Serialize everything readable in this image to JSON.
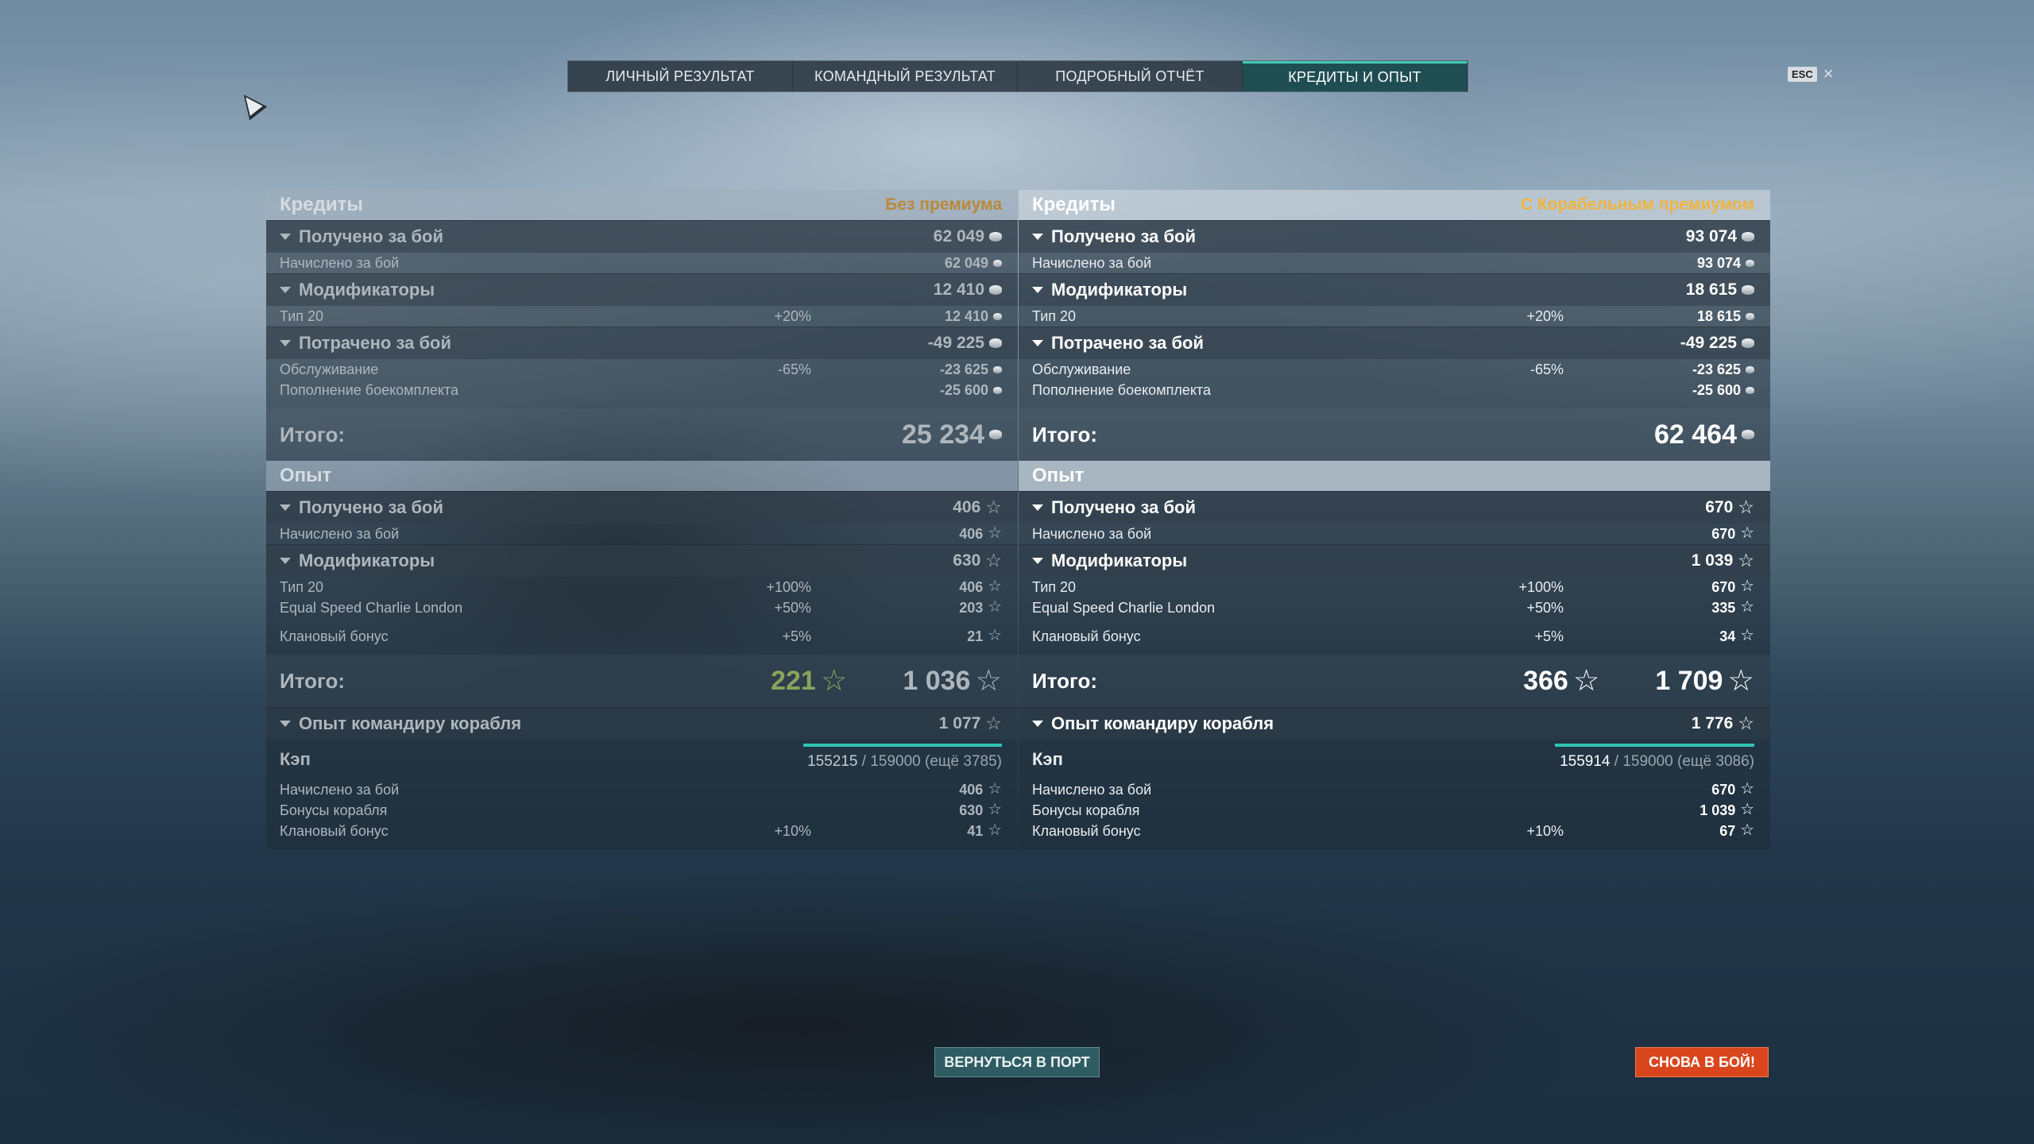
{
  "tabs": [
    "ЛИЧНЫЙ РЕЗУЛЬТАТ",
    "КОМАНДНЫЙ РЕЗУЛЬТАТ",
    "ПОДРОБНЫЙ ОТЧЁТ",
    "КРЕДИТЫ И ОПЫТ"
  ],
  "esc": {
    "key": "ESC",
    "close": "×"
  },
  "icons": {
    "credits": "credit-coin-icon",
    "xp": "star-icon",
    "collapse": "triangle-down-icon"
  },
  "colors": {
    "accent": "#43c9b4",
    "premium": "#f0b43c",
    "battle_button": "#d9461e",
    "bonus_green": "#9fd34a"
  },
  "left": {
    "credits": {
      "title": "Кредиты",
      "premium": "Без премиума",
      "earned": {
        "label": "Получено за бой",
        "value": "62 049",
        "rows": [
          {
            "label": "Начислено за бой",
            "pct": "",
            "value": "62 049"
          }
        ]
      },
      "modifiers": {
        "label": "Модификаторы",
        "value": "12 410",
        "rows": [
          {
            "label": "Тип 20",
            "pct": "+20%",
            "value": "12 410"
          }
        ]
      },
      "spent": {
        "label": "Потрачено за бой",
        "value": "-49 225",
        "rows": [
          {
            "label": "Обслуживание",
            "pct": "-65%",
            "value": "-23 625"
          },
          {
            "label": "Пополнение боекомплекта",
            "pct": "",
            "value": "-25 600"
          }
        ]
      },
      "total": {
        "label": "Итого:",
        "value": "25 234"
      }
    },
    "xp": {
      "title": "Опыт",
      "earned": {
        "label": "Получено за бой",
        "value": "406",
        "rows": [
          {
            "label": "Начислено за бой",
            "pct": "",
            "value": "406"
          }
        ]
      },
      "modifiers": {
        "label": "Модификаторы",
        "value": "630",
        "rows": [
          {
            "label": "Тип 20",
            "pct": "+100%",
            "value": "406"
          },
          {
            "label": "Equal Speed Charlie London",
            "pct": "+50%",
            "value": "203"
          }
        ],
        "clan": {
          "label": "Клановый бонус",
          "pct": "+5%",
          "value": "21"
        }
      },
      "total": {
        "label": "Итого:",
        "free": "221",
        "value": "1 036"
      },
      "commander": {
        "label": "Опыт командиру корабля",
        "value": "1 077"
      },
      "cap": {
        "label": "Кэп",
        "current": "155215",
        "max": "/ 159000 (ещё 3785)",
        "progress": 0.976,
        "rows": [
          {
            "label": "Начислено за бой",
            "pct": "",
            "value": "406"
          },
          {
            "label": "Бонусы корабля",
            "pct": "",
            "value": "630"
          },
          {
            "label": "Клановый бонус",
            "pct": "+10%",
            "value": "41"
          }
        ]
      }
    }
  },
  "right": {
    "credits": {
      "title": "Кредиты",
      "premium": "С Корабельным премиумом",
      "earned": {
        "label": "Получено за бой",
        "value": "93 074",
        "rows": [
          {
            "label": "Начислено за бой",
            "pct": "",
            "value": "93 074"
          }
        ]
      },
      "modifiers": {
        "label": "Модификаторы",
        "value": "18 615",
        "rows": [
          {
            "label": "Тип 20",
            "pct": "+20%",
            "value": "18 615"
          }
        ]
      },
      "spent": {
        "label": "Потрачено за бой",
        "value": "-49 225",
        "rows": [
          {
            "label": "Обслуживание",
            "pct": "-65%",
            "value": "-23 625"
          },
          {
            "label": "Пополнение боекомплекта",
            "pct": "",
            "value": "-25 600"
          }
        ]
      },
      "total": {
        "label": "Итого:",
        "value": "62 464"
      }
    },
    "xp": {
      "title": "Опыт",
      "earned": {
        "label": "Получено за бой",
        "value": "670",
        "rows": [
          {
            "label": "Начислено за бой",
            "pct": "",
            "value": "670"
          }
        ]
      },
      "modifiers": {
        "label": "Модификаторы",
        "value": "1 039",
        "rows": [
          {
            "label": "Тип 20",
            "pct": "+100%",
            "value": "670"
          },
          {
            "label": "Equal Speed Charlie London",
            "pct": "+50%",
            "value": "335"
          }
        ],
        "clan": {
          "label": "Клановый бонус",
          "pct": "+5%",
          "value": "34"
        }
      },
      "total": {
        "label": "Итого:",
        "free": "366",
        "value": "1 709"
      },
      "commander": {
        "label": "Опыт командиру корабля",
        "value": "1 776"
      },
      "cap": {
        "label": "Кэп",
        "current": "155914",
        "max": "/ 159000 (ещё 3086)",
        "progress": 0.981,
        "rows": [
          {
            "label": "Начислено за бой",
            "pct": "",
            "value": "670"
          },
          {
            "label": "Бонусы корабля",
            "pct": "",
            "value": "1 039"
          },
          {
            "label": "Клановый бонус",
            "pct": "+10%",
            "value": "67"
          }
        ]
      }
    }
  },
  "buttons": {
    "port": "ВЕРНУТЬСЯ В ПОРТ",
    "battle": "СНОВА В БОЙ!"
  }
}
